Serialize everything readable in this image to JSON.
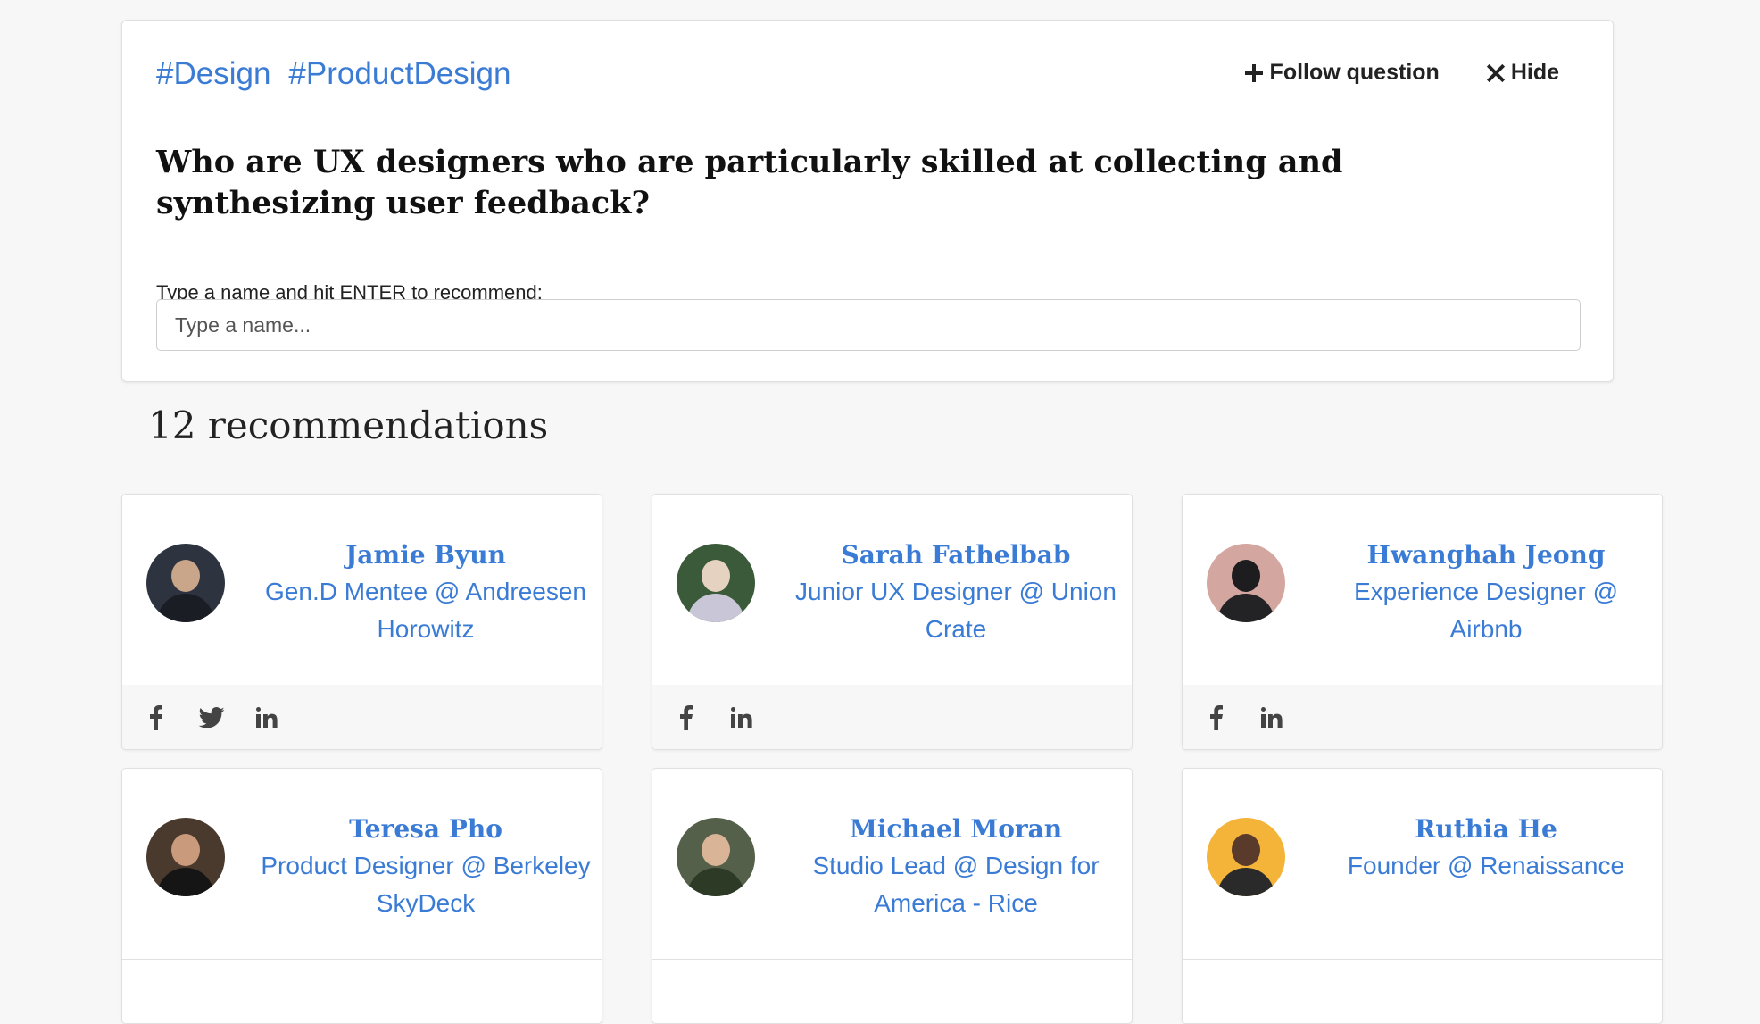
{
  "question": {
    "tags": [
      "#Design",
      "#ProductDesign"
    ],
    "follow_label": "Follow question",
    "hide_label": "Hide",
    "title": "Who are UX designers who are particularly skilled at collecting and synthesizing user feedback?",
    "recommend_label": "Type a name and hit ENTER to recommend:",
    "input_placeholder": "Type a name..."
  },
  "recommendations": {
    "count_label": "12 recommendations",
    "people": [
      {
        "name": "Jamie Byun",
        "title": "Gen.D Mentee @ Andreesen Horowitz",
        "socials": [
          "facebook-icon",
          "twitter-icon",
          "linkedin-icon"
        ]
      },
      {
        "name": "Sarah Fathelbab",
        "title": "Junior UX Designer @ Union Crate",
        "socials": [
          "facebook-icon",
          "linkedin-icon"
        ]
      },
      {
        "name": "Hwanghah Jeong",
        "title": "Experience Designer @ Airbnb",
        "socials": [
          "facebook-icon",
          "linkedin-icon"
        ]
      },
      {
        "name": "Teresa Pho",
        "title": "Product Designer @ Berkeley SkyDeck",
        "socials": []
      },
      {
        "name": "Michael Moran",
        "title": "Studio Lead @ Design for America - Rice",
        "socials": []
      },
      {
        "name": "Ruthia He",
        "title": "Founder @ Renaissance",
        "socials": []
      }
    ]
  },
  "colors": {
    "link": "#3a7bd5",
    "background": "#f7f7f7"
  }
}
